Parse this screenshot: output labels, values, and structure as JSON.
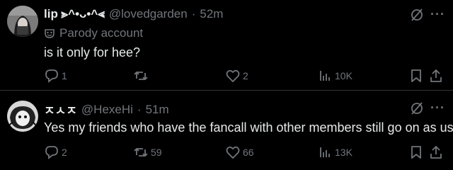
{
  "post1": {
    "display_name": "lip ⪢^•ᴗ•^⪡",
    "handle": "@lovedgarden",
    "separator": "·",
    "time": "52m",
    "parody_label": "Parody account",
    "text": "is it only for hee?",
    "actions": {
      "replies": "1",
      "reposts": "",
      "likes": "2",
      "views": "10K"
    },
    "icons": {
      "hide": "eye-slash-icon",
      "more": "more-icon",
      "parody": "parody-mask-icon",
      "reply": "reply-icon",
      "repost": "repost-icon",
      "like": "like-icon",
      "views": "views-icon",
      "bookmark": "bookmark-icon",
      "share": "share-icon"
    }
  },
  "post2": {
    "display_name": "ㅈㅅㅈ",
    "handle": "@HexeHi",
    "separator": "·",
    "time": "51m",
    "text": "Yes my friends who have the fancall with other members still go on as usual",
    "actions": {
      "replies": "2",
      "reposts": "59",
      "likes": "66",
      "views": "13K"
    }
  },
  "colors": {
    "background": "#000000",
    "text_primary": "#e7e9ea",
    "text_secondary": "#71767b",
    "divider": "#2f3336"
  }
}
